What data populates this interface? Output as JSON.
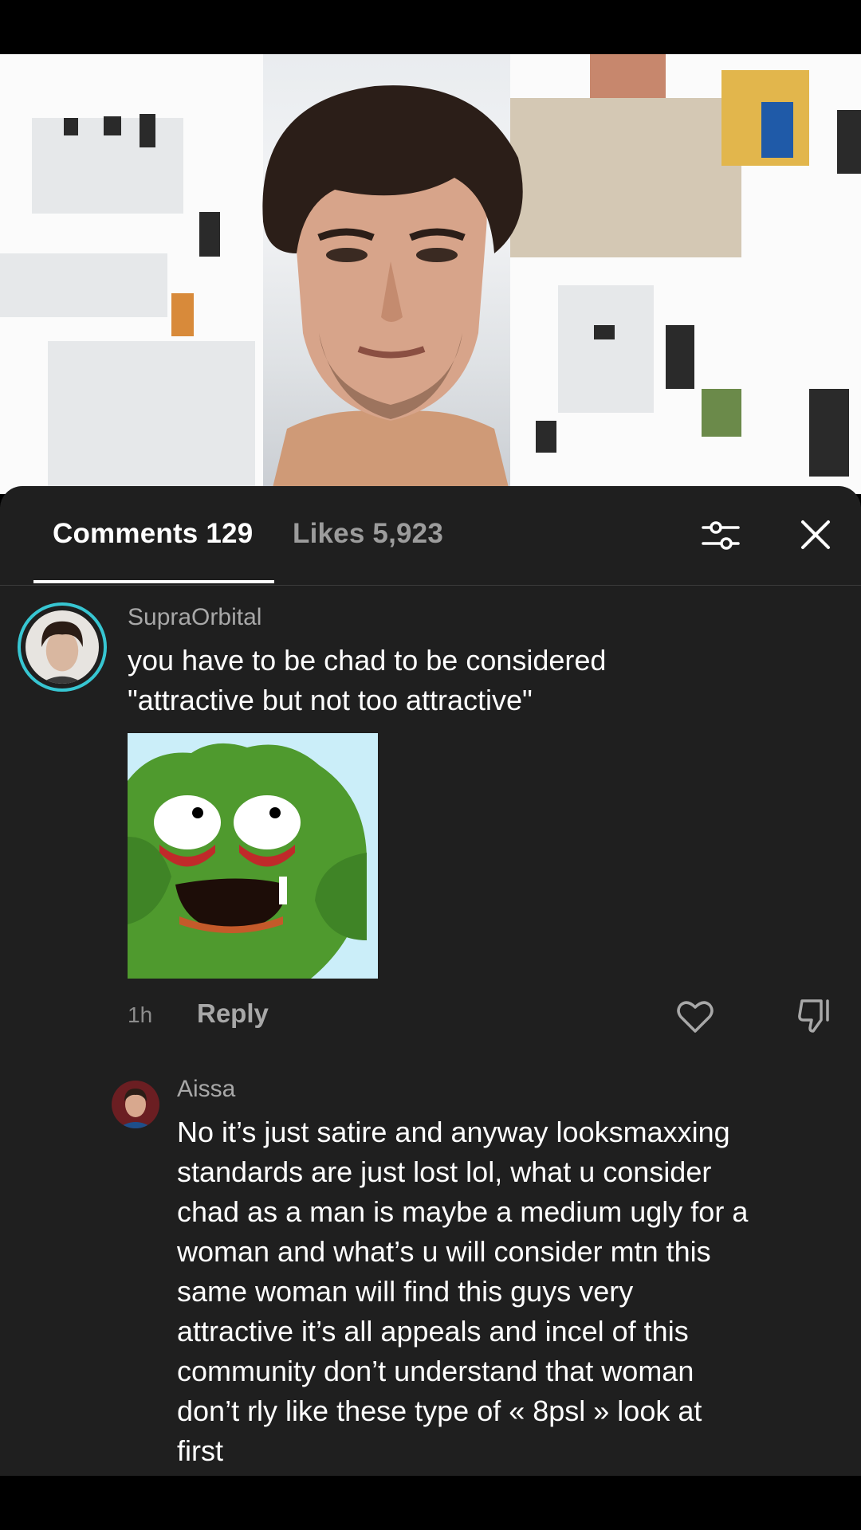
{
  "tabs": {
    "comments_label": "Comments 129",
    "likes_label": "Likes 5,923"
  },
  "comments": [
    {
      "username": "SupraOrbital",
      "text_lines": [
        "you have to be chad to be considered",
        "\"attractive but not too attractive\""
      ],
      "time": "1h",
      "reply_label": "Reply"
    }
  ],
  "replies": [
    {
      "username": "Aissa",
      "text_lines": [
        "No it’s just satire and anyway looksmaxxing",
        "standards are just lost lol, what u consider",
        "chad as a man is maybe a medium ugly for a",
        "woman and what’s u will consider mtn this",
        "same woman will find this guys very",
        "attractive it’s all appeals and incel of this",
        "community don’t understand that woman",
        "don’t rly like these type of « 8psl » look at",
        "first"
      ]
    }
  ],
  "colors": {
    "sheet_bg": "#1f1f1f",
    "avatar_ring": "#37c6d2",
    "muted_text": "#a8a8a8"
  },
  "icons": [
    "filter-icon",
    "close-icon",
    "heart-icon",
    "dislike-icon"
  ]
}
